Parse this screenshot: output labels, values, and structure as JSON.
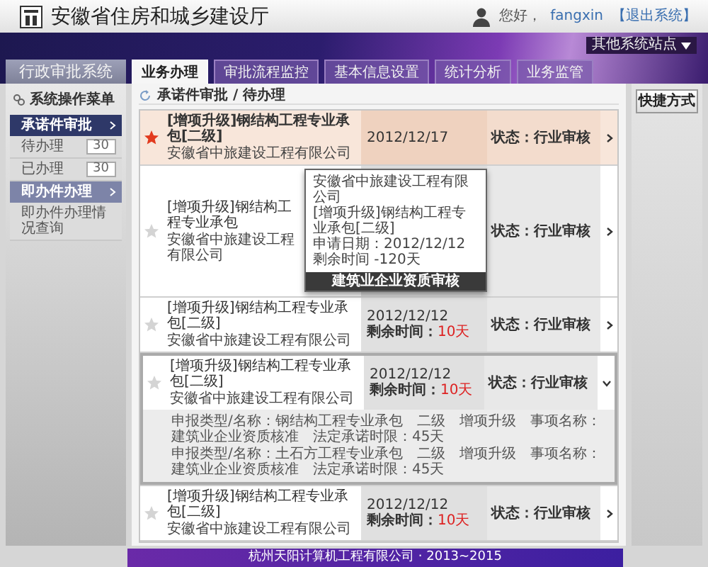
{
  "header": {
    "title": "安徽省住房和城乡建设厅",
    "greeting": "您好，",
    "user": "fangxin",
    "logout": "【退出系统】"
  },
  "banner": {
    "site_menu": "其他系统站点",
    "system_name": "行政审批系统"
  },
  "tabs": [
    {
      "label": "业务办理",
      "selected": true
    },
    {
      "label": "审批流程监控",
      "selected": false
    },
    {
      "label": "基本信息设置",
      "selected": false
    },
    {
      "label": "统计分析",
      "selected": false
    },
    {
      "label": "业务监管",
      "selected": false
    }
  ],
  "sidebar": {
    "title": "系统操作菜单",
    "groups": [
      {
        "label": "承诺件审批",
        "selected": true,
        "children": [
          {
            "label": "待办理",
            "count": "30"
          },
          {
            "label": "已办理",
            "count": "30"
          }
        ]
      },
      {
        "label": "即办件办理",
        "selected": false,
        "children": [
          {
            "label": "即办件办理情况查询"
          }
        ]
      }
    ]
  },
  "breadcrumb": "承诺件审批 / 待办理",
  "rows": [
    {
      "title": "[增项升级]钢结构工程专业承包[二级]",
      "company": "安徽省中旅建设工程有限公司",
      "date": "2012/12/17",
      "status": "状态：行业审核",
      "starred": true,
      "selected": true,
      "expanded": false
    },
    {
      "title": "[增项升级]钢结构工程专业承包",
      "company": "安徽省中旅建设工程有限公司",
      "status": "状态：行业审核",
      "starred": false,
      "selected": false,
      "expanded": false,
      "tooltip": {
        "lines": [
          "安徽省中旅建设工程有限公司",
          "[增项升级]钢结构工程专业承包[二级]",
          "申请日期：2012/12/12",
          "剩余时间 -120天"
        ],
        "footer": "建筑业企业资质审核"
      }
    },
    {
      "title": "[增项升级]钢结构工程专业承包[二级]",
      "company": "安徽省中旅建设工程有限公司",
      "date": "2012/12/12",
      "remaining_label": "剩余时间：",
      "remaining": "10天",
      "status": "状态：行业审核",
      "starred": false,
      "selected": false,
      "expanded": false
    },
    {
      "title": "[增项升级]钢结构工程专业承包[二级]",
      "company": "安徽省中旅建设工程有限公司",
      "date": "2012/12/12",
      "remaining_label": "剩余时间：",
      "remaining": "10天",
      "status": "状态：行业审核",
      "starred": false,
      "selected": false,
      "expanded": true,
      "details": [
        "申报类型/名称：钢结构工程专业承包　二级　增项升级　事项名称：建筑业企业资质核准　法定承诺时限：45天",
        "申报类型/名称：土石方工程专业承包　二级　增项升级　事项名称：建筑业企业资质核准　法定承诺时限：45天"
      ]
    },
    {
      "title": "[增项升级]钢结构工程专业承包[二级]",
      "company": "安徽省中旅建设工程有限公司",
      "date": "2012/12/12",
      "remaining_label": "剩余时间：",
      "remaining": "10天",
      "status": "状态：行业审核",
      "starred": false,
      "selected": false,
      "expanded": false
    }
  ],
  "shortcut": "快捷方式",
  "footer": "杭州天阳计算机工程有限公司 · 2013~2015"
}
